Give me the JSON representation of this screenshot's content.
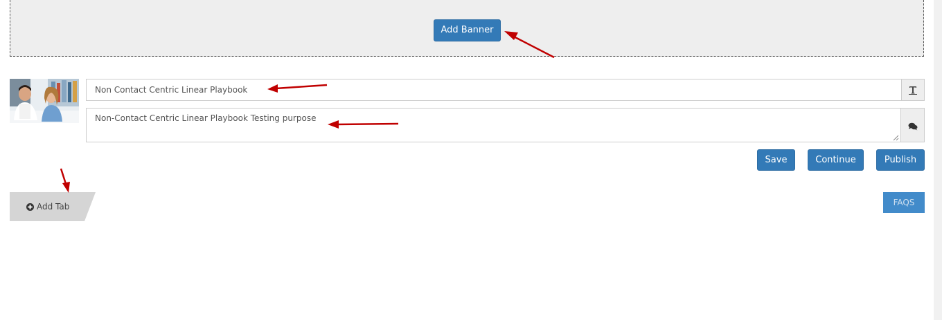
{
  "banner": {
    "add_banner_label": "Add Banner"
  },
  "playbook": {
    "title_value": "Non Contact Centric Linear Playbook",
    "description_value": "Non-Contact Centric Linear Playbook Testing purpose",
    "title_addon_icon": "text-format-icon",
    "description_addon_icon": "comments-icon"
  },
  "actions": {
    "save_label": "Save",
    "continue_label": "Continue",
    "publish_label": "Publish"
  },
  "tabs": {
    "add_tab_label": "Add Tab",
    "add_tab_icon": "plus-circle-icon"
  },
  "faqs": {
    "label": "FAQS"
  },
  "colors": {
    "primary": "#337ab7",
    "faqs_button": "#428bca",
    "annotation_arrow": "#c00000",
    "banner_bg": "#eeeeee",
    "tab_bg": "#d5d5d5"
  }
}
